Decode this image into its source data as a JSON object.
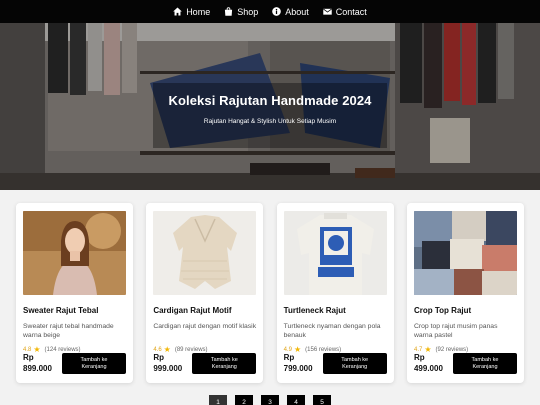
{
  "nav": {
    "items": [
      {
        "label": "Home",
        "icon": "home-icon"
      },
      {
        "label": "Shop",
        "icon": "shopping-bag-icon"
      },
      {
        "label": "About",
        "icon": "info-icon"
      },
      {
        "label": "Contact",
        "icon": "envelope-icon"
      }
    ]
  },
  "hero": {
    "title": "Koleksi Rajutan Handmade 2024",
    "subtitle": "Rajutan Hangat & Stylish Untuk Setiap Musim"
  },
  "products": [
    {
      "name": "Sweater Rajut Tebal",
      "description": "Sweater rajut tebal handmade warna beige",
      "rating": "4.8",
      "reviews": "(124 reviews)",
      "currency": "Rp",
      "price": "899.000",
      "button": "Tambah ke Keranjang"
    },
    {
      "name": "Cardigan Rajut Motif",
      "description": "Cardigan rajut dengan motif klasik",
      "rating": "4.6",
      "reviews": "(89 reviews)",
      "currency": "Rp",
      "price": "999.000",
      "button": "Tambah ke Keranjang"
    },
    {
      "name": "Turtleneck Rajut",
      "description": "Turtleneck nyaman dengan pola benauk",
      "rating": "4.9",
      "reviews": "(156 reviews)",
      "currency": "Rp",
      "price": "799.000",
      "button": "Tambah ke Keranjang"
    },
    {
      "name": "Crop Top Rajut",
      "description": "Crop top rajut musim panas warna pastel",
      "rating": "4.7",
      "reviews": "(92 reviews)",
      "currency": "Rp",
      "price": "499.000",
      "button": "Tambah ke Keranjang"
    }
  ],
  "pagination": {
    "pages": [
      "1",
      "2",
      "3",
      "4",
      "5"
    ],
    "current": "1"
  },
  "colors": {
    "nav_bg": "#050505",
    "button_bg": "#000000",
    "star": "#f2b705",
    "page_bg": "#f2f2f2"
  }
}
